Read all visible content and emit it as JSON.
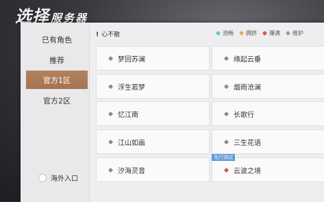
{
  "title": {
    "big": "选择",
    "small": "服务器"
  },
  "sidebar": {
    "items": [
      {
        "label": "已有角色"
      },
      {
        "label": "推荐"
      },
      {
        "label": "官方1区"
      },
      {
        "label": "官方2区"
      }
    ],
    "active_index": 2,
    "overseas_label": "海外入口"
  },
  "header": {
    "notice": "心不散",
    "notice_icon": "!",
    "legend": [
      {
        "label": "流畅",
        "color": "#5fc4c9"
      },
      {
        "label": "拥挤",
        "color": "#e0b24a"
      },
      {
        "label": "爆满",
        "color": "#d9534f"
      },
      {
        "label": "维护",
        "color": "#9a9a9a"
      }
    ]
  },
  "servers": [
    {
      "name": "梦回苏澜",
      "status_color": "#8a8a8a"
    },
    {
      "name": "缘起云垂",
      "status_color": "#8a8a8a"
    },
    {
      "name": "浮生若梦",
      "status_color": "#8a8a8a"
    },
    {
      "name": "烟雨沧澜",
      "status_color": "#8a8a8a"
    },
    {
      "name": "忆江南",
      "status_color": "#8a8a8a"
    },
    {
      "name": "长歌行",
      "status_color": "#8a8a8a"
    },
    {
      "name": "江山如画",
      "status_color": "#8a8a8a"
    },
    {
      "name": "三生花语",
      "status_color": "#8a8a8a"
    },
    {
      "name": "汐海灵音",
      "status_color": "#8a8a8a"
    },
    {
      "name": "云波之境",
      "status_color": "#d9534f",
      "tag": "先行测试"
    }
  ],
  "colors": {
    "active_tab": "#a97853",
    "test_tag": "#5b9ad6"
  }
}
